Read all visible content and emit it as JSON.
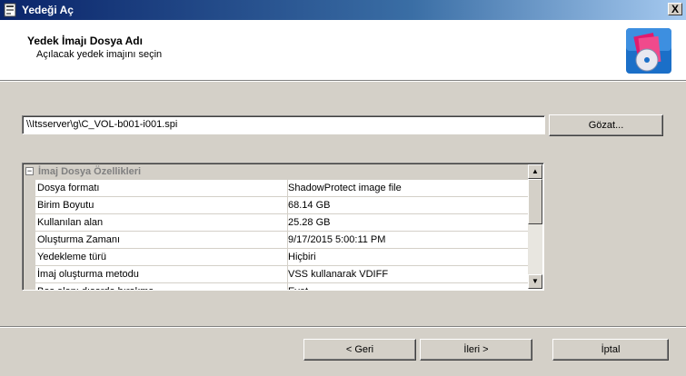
{
  "window": {
    "title": "Yedeği Aç",
    "close_label": "X"
  },
  "header": {
    "title": "Yedek İmajı Dosya Adı",
    "subtitle": "Açılacak yedek imajını seçin"
  },
  "file": {
    "path": "\\\\Itsserver\\g\\C_VOL-b001-i001.spi",
    "browse_label": "Gözat..."
  },
  "properties": {
    "group_title": "İmaj Dosya Özellikleri",
    "toggle": "−",
    "rows": [
      {
        "name": "Dosya formatı",
        "value": "ShadowProtect image file"
      },
      {
        "name": "Birim Boyutu",
        "value": "68.14 GB"
      },
      {
        "name": "Kullanılan alan",
        "value": "25.28 GB"
      },
      {
        "name": "Oluşturma Zamanı",
        "value": "9/17/2015 5:00:11 PM"
      },
      {
        "name": "Yedekleme türü",
        "value": "Hiçbiri"
      },
      {
        "name": "İmaj oluşturma metodu",
        "value": "VSS kullanarak VDIFF"
      },
      {
        "name": "Boş alanı dışarda bırakma",
        "value": "Evet"
      }
    ],
    "scroll_up": "▲",
    "scroll_down": "▼"
  },
  "footer": {
    "back_label": "< Geri",
    "next_label": "İleri >",
    "cancel_label": "İptal"
  },
  "colors": {
    "titlebar": "#0a246a",
    "dialog_bg": "#d4d0c8"
  }
}
